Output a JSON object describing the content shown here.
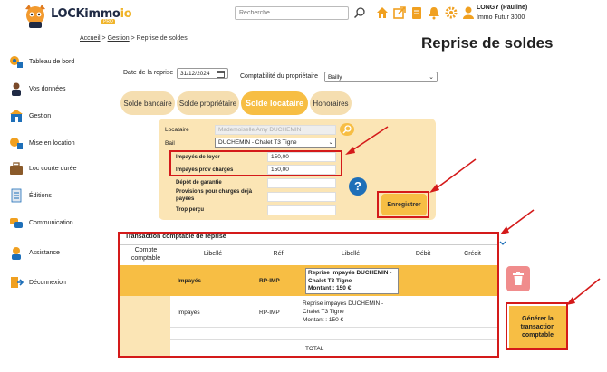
{
  "header": {
    "logo_text": "LOCKimmo",
    "logo_suffix": "io",
    "logo_sub": "PRO",
    "search_placeholder": "Recherche ...",
    "user_name": "LONGY (Pauline)",
    "user_company": "Immo Futur 3000"
  },
  "breadcrumb": {
    "home": "Accueil",
    "sep1": " > ",
    "gestion": "Gestion",
    "sep2": " > ",
    "current": "Reprise de soldes"
  },
  "page_title": "Reprise de soldes",
  "sidebar": {
    "items": [
      {
        "label": "Tableau de bord",
        "icon": "dashboard-icon"
      },
      {
        "label": "Vos données",
        "icon": "user-icon"
      },
      {
        "label": "Gestion",
        "icon": "gestion-icon"
      },
      {
        "label": "Mise en location",
        "icon": "rental-icon"
      },
      {
        "label": "Loc courte durée",
        "icon": "suitcase-icon"
      },
      {
        "label": "Éditions",
        "icon": "document-icon"
      },
      {
        "label": "Communication",
        "icon": "chat-icon"
      },
      {
        "label": "Assistance",
        "icon": "support-icon"
      },
      {
        "label": "Déconnexion",
        "icon": "logout-icon"
      }
    ]
  },
  "form": {
    "date_label": "Date de la reprise",
    "date_value": "31/12/2024",
    "compta_label": "Comptabilité du propriétaire",
    "compta_value": "Bailly"
  },
  "tabs": [
    {
      "label": "Solde bancaire",
      "active": false
    },
    {
      "label": "Solde propriétaire",
      "active": false
    },
    {
      "label": "Solde locataire",
      "active": true
    },
    {
      "label": "Honoraires",
      "active": false
    }
  ],
  "panel": {
    "locataire_label": "Locataire",
    "locataire_value": "Mademoiselle Amy DUCHEMIN",
    "bail_label": "Bail",
    "bail_value": "DUCHEMIN - Chalet T3 Tigne",
    "impayes_loyer_label": "Impayés de loyer",
    "impayes_loyer_value": "150,00",
    "impayes_prov_label": "Impayés prov charges",
    "impayes_prov_value": "150,00",
    "depot_label": "Dépôt de garantie",
    "depot_value": "",
    "provisions_label": "Provisions pour charges déjà payées",
    "provisions_value": "",
    "trop_percu_label": "Trop perçu",
    "trop_percu_value": "",
    "help_label": "?",
    "save_label": "Enregistrer"
  },
  "table": {
    "title": "Transaction comptable de reprise",
    "columns": [
      "Compte comptable",
      "Libellé",
      "Réf",
      "Libellé",
      "Débit",
      "Crédit"
    ],
    "rows": [
      {
        "libelle": "Impayés",
        "ref": "RP-IMP",
        "libelle2": "Reprise impayés DUCHEMIN - Chalet T3  Tigne\nMontant : 150 €"
      },
      {
        "libelle": "Impayés",
        "ref": "RP-IMP",
        "libelle2": "Reprise impayés DUCHEMIN - Chalet T3 Tigne\nMontant : 150 €"
      }
    ],
    "total_label": "TOTAL"
  },
  "generate_label": "Générer la transaction comptable",
  "colors": {
    "accent": "#f7be44",
    "tab_inactive": "#f5deb0",
    "panel": "#fbe5b5",
    "annotation": "#d41a1a",
    "help": "#1e6fb8",
    "trash": "#f08c8c"
  }
}
